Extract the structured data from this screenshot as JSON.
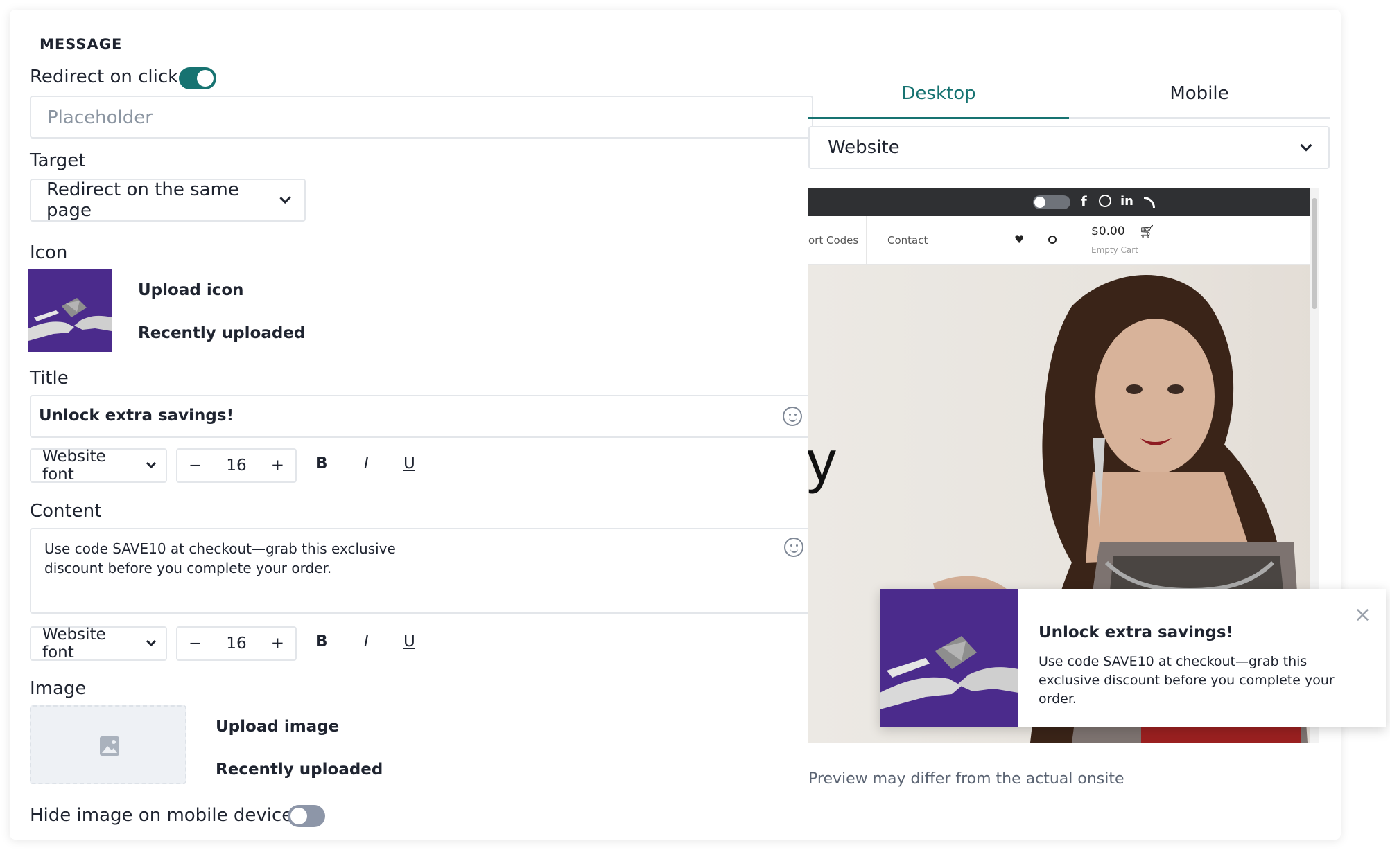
{
  "section": {
    "title": "MESSAGE"
  },
  "redirect": {
    "label": "Redirect on click",
    "enabled": true,
    "placeholder": "Placeholder"
  },
  "target": {
    "label": "Target",
    "value": "Redirect on the same page"
  },
  "icon": {
    "label": "Icon",
    "upload": "Upload icon",
    "recent": "Recently uploaded"
  },
  "title_field": {
    "label": "Title",
    "value": "Unlock extra savings!",
    "font": "Website font",
    "size": "16",
    "bold": "B",
    "italic": "I",
    "underline": "U"
  },
  "content_field": {
    "label": "Content",
    "value": "Use code SAVE10 at checkout—grab this exclusive discount before you complete your order.",
    "font": "Website font",
    "size": "16",
    "bold": "B",
    "italic": "I",
    "underline": "U"
  },
  "image": {
    "label": "Image",
    "upload": "Upload image",
    "recent": "Recently uploaded"
  },
  "hide_mobile": {
    "label": "Hide image on mobile devices",
    "enabled": false
  },
  "preview": {
    "tabs": [
      {
        "label": "Desktop",
        "active": true
      },
      {
        "label": "Mobile",
        "active": false
      }
    ],
    "source": "Website",
    "site_nav": {
      "item1": "ort Codes",
      "item2": "Contact",
      "cart_price": "$0.00",
      "cart_status": "Empty Cart",
      "hero_partial": "y"
    },
    "social_icons": [
      "facebook-icon",
      "dribbble-icon",
      "linkedin-icon",
      "rss-icon"
    ],
    "popup": {
      "title": "Unlock extra savings!",
      "text": "Use code SAVE10 at checkout—grab this exclusive discount before you complete your order.",
      "close": "×"
    },
    "note": "Preview may differ from the actual onsite"
  },
  "colors": {
    "accent": "#177371",
    "toggle_off": "#8d96a8",
    "icon_bg": "#4b2b8c",
    "topbar": "#2f3033"
  }
}
